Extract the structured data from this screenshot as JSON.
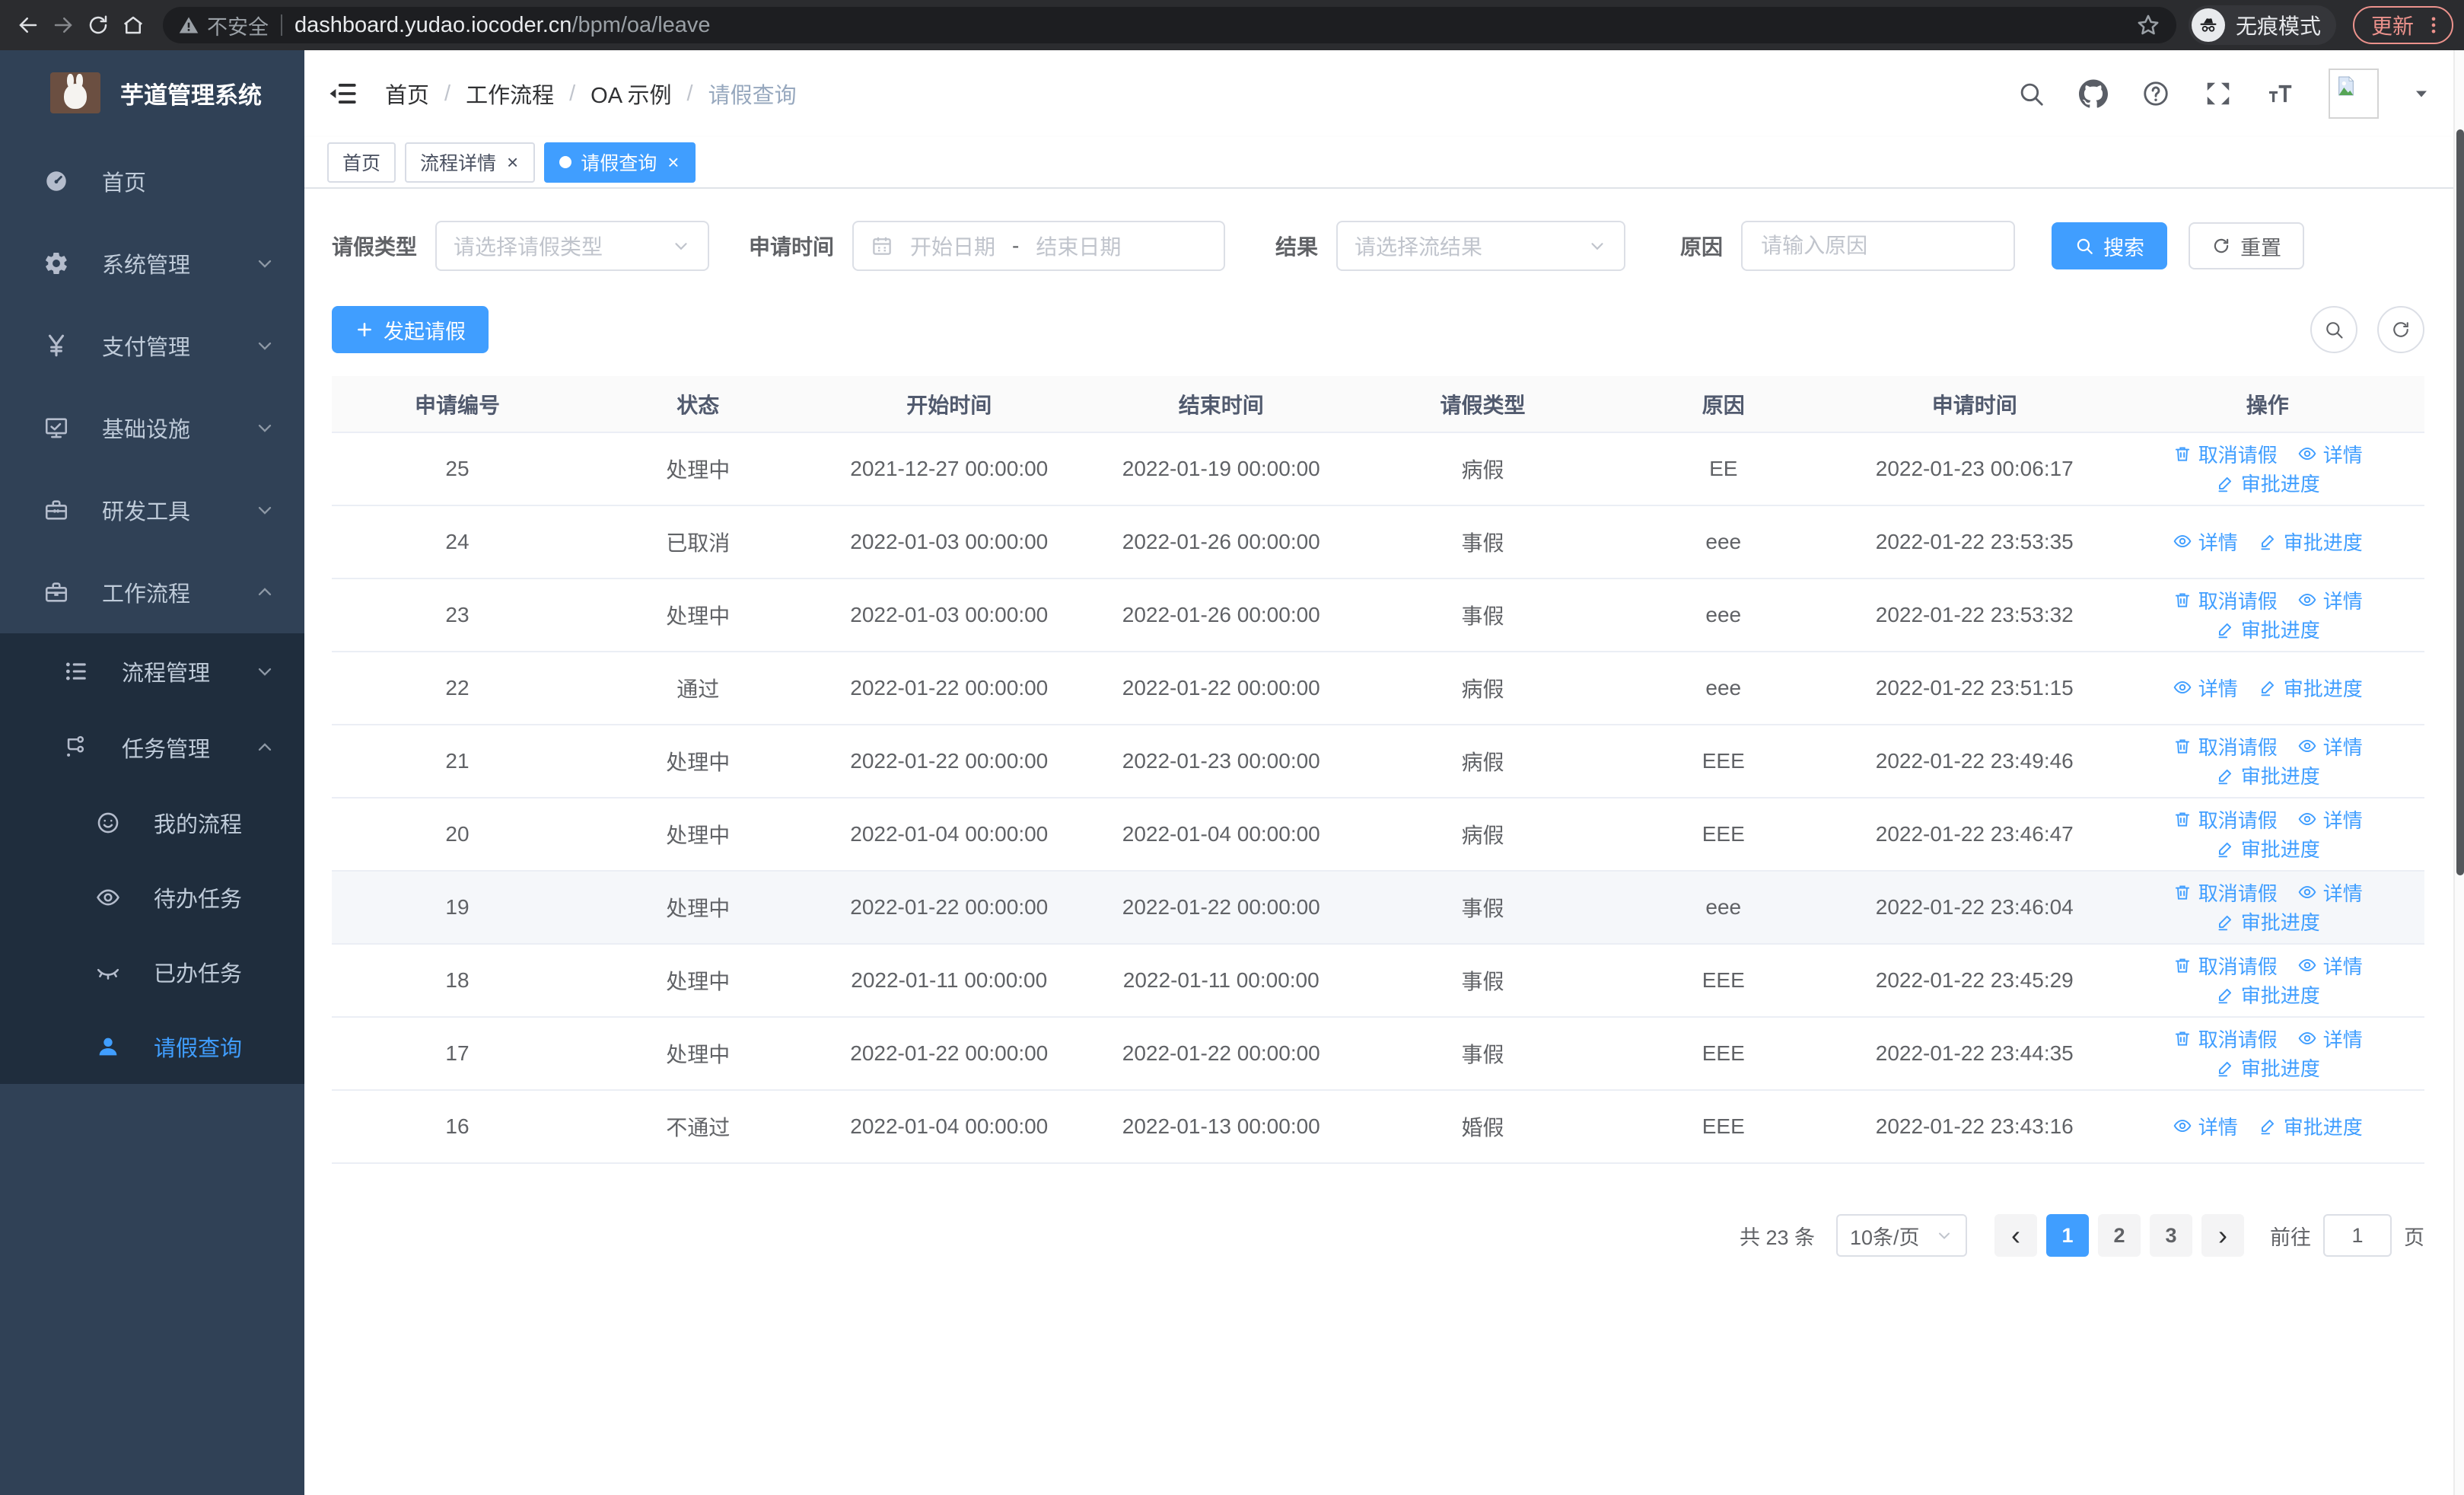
{
  "colors": {
    "accent": "#409eff",
    "sidebar_bg": "#304156",
    "submenu_bg": "#1f2d3d",
    "update_accent": "#ec928c"
  },
  "browser": {
    "nav_icons": [
      {
        "key": "back"
      },
      {
        "key": "forward"
      },
      {
        "key": "reload"
      },
      {
        "key": "home"
      }
    ],
    "security_warning": "不安全",
    "url_host": "dashboard.yudao.iocoder.cn",
    "url_path": "/bpm/oa/leave",
    "incognito_label": "无痕模式",
    "update_button": "更新"
  },
  "sidebar": {
    "app_title": "芋道管理系统",
    "items": [
      {
        "key": "home",
        "label": "首页",
        "icon": "dashboard",
        "level": 1
      },
      {
        "key": "system-management",
        "label": "系统管理",
        "icon": "gear",
        "level": 1,
        "chevron": "down"
      },
      {
        "key": "payment-management",
        "label": "支付管理",
        "icon": "yen",
        "level": 1,
        "chevron": "down"
      },
      {
        "key": "infrastructure",
        "label": "基础设施",
        "icon": "monitor",
        "level": 1,
        "chevron": "down"
      },
      {
        "key": "dev-tools",
        "label": "研发工具",
        "icon": "toolbox",
        "level": 1,
        "chevron": "down"
      },
      {
        "key": "workflow",
        "label": "工作流程",
        "icon": "briefcase",
        "level": 1,
        "chevron": "up",
        "expanded": true,
        "children": [
          {
            "key": "process-management",
            "label": "流程管理",
            "icon": "listtree",
            "level": 2,
            "chevron": "down"
          },
          {
            "key": "task-management",
            "label": "任务管理",
            "icon": "flow",
            "level": 2,
            "chevron": "up",
            "expanded": true,
            "children": [
              {
                "key": "my-processes",
                "label": "我的流程",
                "icon": "face",
                "level": 3
              },
              {
                "key": "todo-tasks",
                "label": "待办任务",
                "icon": "eye",
                "level": 3
              },
              {
                "key": "done-tasks",
                "label": "已办任务",
                "icon": "eyeclosed",
                "level": 3
              },
              {
                "key": "leave-query",
                "label": "请假查询",
                "icon": "user",
                "level": 3,
                "active": true
              }
            ]
          }
        ]
      }
    ]
  },
  "header": {
    "breadcrumb": [
      "首页",
      "工作流程",
      "OA 示例",
      "请假查询"
    ],
    "icons": [
      {
        "key": "search"
      },
      {
        "key": "github"
      },
      {
        "key": "help"
      },
      {
        "key": "fullscreen"
      },
      {
        "key": "fontsize"
      },
      {
        "key": "avatar"
      },
      {
        "key": "dropdown"
      }
    ]
  },
  "tabs": [
    {
      "key": "home",
      "label": "首页",
      "closable": false,
      "active": false
    },
    {
      "key": "process-detail",
      "label": "流程详情",
      "closable": true,
      "active": false
    },
    {
      "key": "leave-query",
      "label": "请假查询",
      "closable": true,
      "active": true
    }
  ],
  "filters": {
    "leave_type_label": "请假类型",
    "leave_type_placeholder": "请选择请假类型",
    "apply_time_label": "申请时间",
    "start_date_placeholder": "开始日期",
    "date_separator": "-",
    "end_date_placeholder": "结束日期",
    "result_label": "结果",
    "result_placeholder": "请选择流结果",
    "reason_label": "原因",
    "reason_placeholder": "请输入原因",
    "search_button": "搜索",
    "reset_button": "重置"
  },
  "toolbar": {
    "create_button": "发起请假"
  },
  "table": {
    "columns": [
      "申请编号",
      "状态",
      "开始时间",
      "结束时间",
      "请假类型",
      "原因",
      "申请时间",
      "操作"
    ],
    "action_defs": {
      "cancel": {
        "label": "取消请假",
        "icon": "trash"
      },
      "detail": {
        "label": "详情",
        "icon": "eyeo"
      },
      "progress": {
        "label": "审批进度",
        "icon": "pen"
      }
    },
    "rows": [
      {
        "id": "25",
        "status": "处理中",
        "start": "2021-12-27 00:00:00",
        "end": "2022-01-19 00:00:00",
        "type": "病假",
        "reason": "EE",
        "apply_time": "2022-01-23 00:06:17",
        "actions": [
          "cancel",
          "detail",
          "progress"
        ],
        "highlighted": false
      },
      {
        "id": "24",
        "status": "已取消",
        "start": "2022-01-03 00:00:00",
        "end": "2022-01-26 00:00:00",
        "type": "事假",
        "reason": "eee",
        "apply_time": "2022-01-22 23:53:35",
        "actions": [
          "detail",
          "progress"
        ],
        "highlighted": false
      },
      {
        "id": "23",
        "status": "处理中",
        "start": "2022-01-03 00:00:00",
        "end": "2022-01-26 00:00:00",
        "type": "事假",
        "reason": "eee",
        "apply_time": "2022-01-22 23:53:32",
        "actions": [
          "cancel",
          "detail",
          "progress"
        ],
        "highlighted": false
      },
      {
        "id": "22",
        "status": "通过",
        "start": "2022-01-22 00:00:00",
        "end": "2022-01-22 00:00:00",
        "type": "病假",
        "reason": "eee",
        "apply_time": "2022-01-22 23:51:15",
        "actions": [
          "detail",
          "progress"
        ],
        "highlighted": false
      },
      {
        "id": "21",
        "status": "处理中",
        "start": "2022-01-22 00:00:00",
        "end": "2022-01-23 00:00:00",
        "type": "病假",
        "reason": "EEE",
        "apply_time": "2022-01-22 23:49:46",
        "actions": [
          "cancel",
          "detail",
          "progress"
        ],
        "highlighted": false
      },
      {
        "id": "20",
        "status": "处理中",
        "start": "2022-01-04 00:00:00",
        "end": "2022-01-04 00:00:00",
        "type": "病假",
        "reason": "EEE",
        "apply_time": "2022-01-22 23:46:47",
        "actions": [
          "cancel",
          "detail",
          "progress"
        ],
        "highlighted": false
      },
      {
        "id": "19",
        "status": "处理中",
        "start": "2022-01-22 00:00:00",
        "end": "2022-01-22 00:00:00",
        "type": "事假",
        "reason": "eee",
        "apply_time": "2022-01-22 23:46:04",
        "actions": [
          "cancel",
          "detail",
          "progress"
        ],
        "highlighted": true
      },
      {
        "id": "18",
        "status": "处理中",
        "start": "2022-01-11 00:00:00",
        "end": "2022-01-11 00:00:00",
        "type": "事假",
        "reason": "EEE",
        "apply_time": "2022-01-22 23:45:29",
        "actions": [
          "cancel",
          "detail",
          "progress"
        ],
        "highlighted": false
      },
      {
        "id": "17",
        "status": "处理中",
        "start": "2022-01-22 00:00:00",
        "end": "2022-01-22 00:00:00",
        "type": "事假",
        "reason": "EEE",
        "apply_time": "2022-01-22 23:44:35",
        "actions": [
          "cancel",
          "detail",
          "progress"
        ],
        "highlighted": false
      },
      {
        "id": "16",
        "status": "不通过",
        "start": "2022-01-04 00:00:00",
        "end": "2022-01-13 00:00:00",
        "type": "婚假",
        "reason": "EEE",
        "apply_time": "2022-01-22 23:43:16",
        "actions": [
          "detail",
          "progress"
        ],
        "highlighted": false
      }
    ]
  },
  "pagination": {
    "total_text": "共 23 条",
    "page_size_value": "10条/页",
    "prev_symbol": "‹",
    "next_symbol": "›",
    "pages": [
      "1",
      "2",
      "3"
    ],
    "active_page": "1",
    "goto_label": "前往",
    "goto_value": "1",
    "goto_suffix": "页"
  }
}
